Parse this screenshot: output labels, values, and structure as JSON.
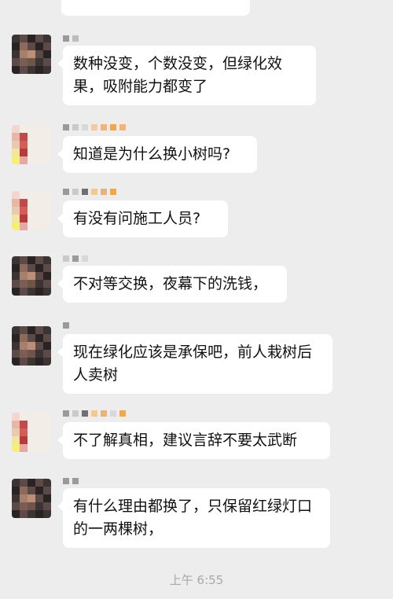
{
  "messages": [
    {
      "text": "数种没变，个数没变，但绿化效果，吸附能力都变了"
    },
    {
      "text": "知道是为什么换小树吗?"
    },
    {
      "text": "有没有问施工人员?"
    },
    {
      "text": "不对等交换，夜幕下的洗钱，"
    },
    {
      "text": "现在绿化应该是承保吧，前人栽树后人卖树"
    },
    {
      "text": "不了解真相，建议言辞不要太武断"
    },
    {
      "text": "有什么理由都换了，只保留红绿灯口的一两棵树，"
    }
  ],
  "timestamp": "上午 6:55"
}
